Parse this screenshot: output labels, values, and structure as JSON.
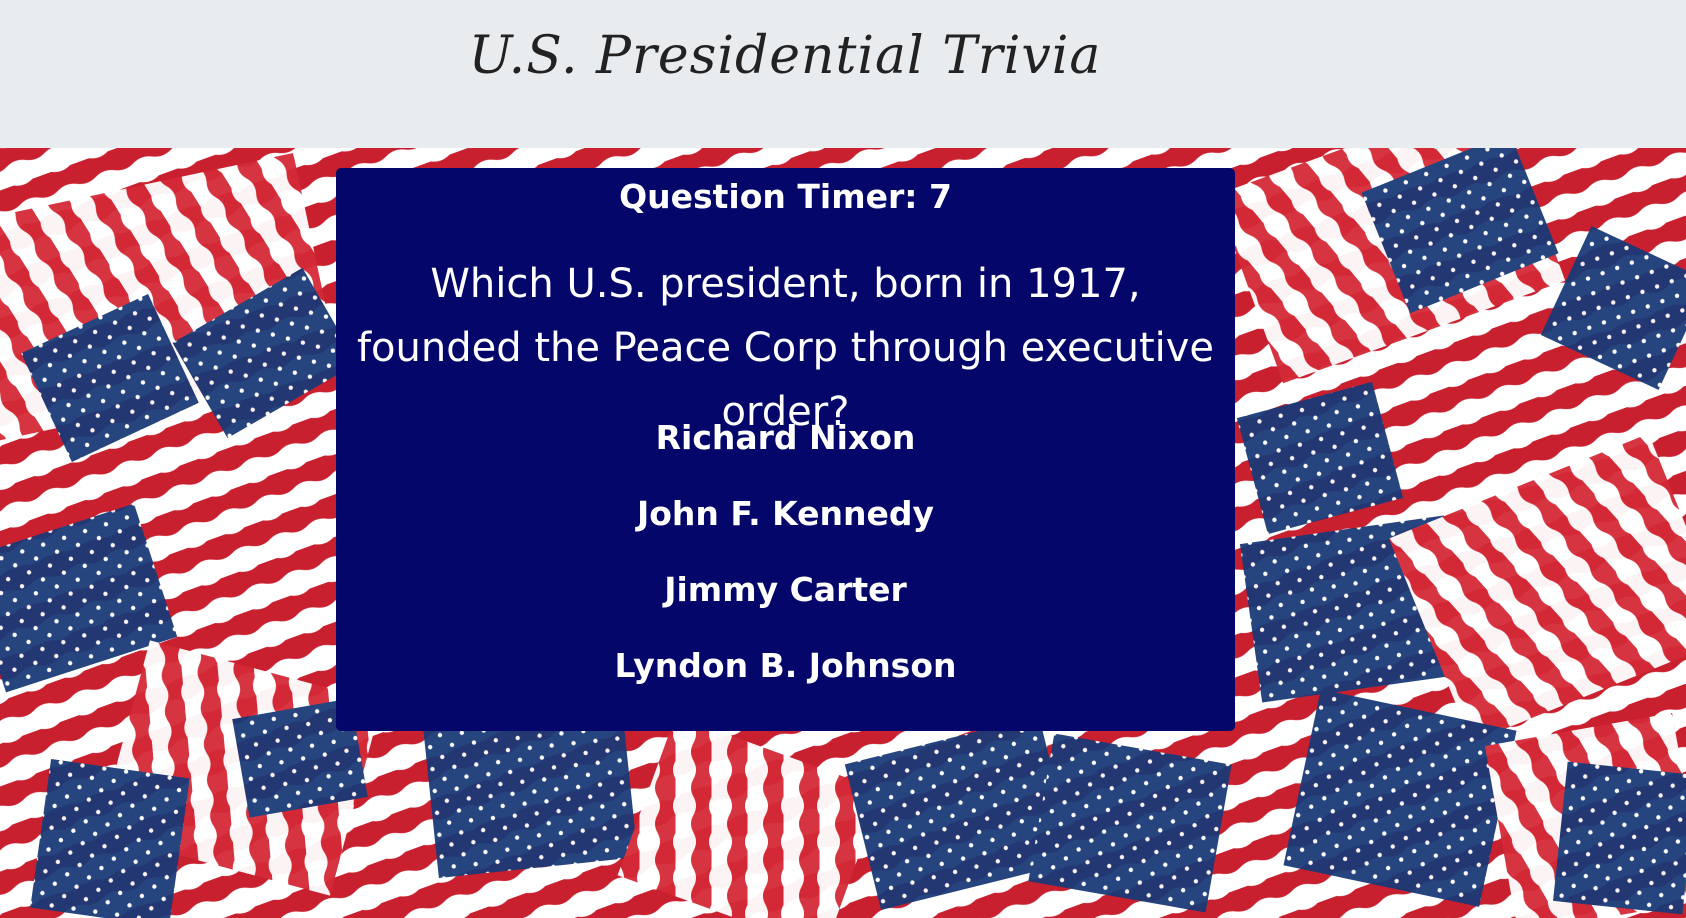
{
  "header": {
    "title": "U.S. Presidential Trivia"
  },
  "card": {
    "timer_label": "Question Timer:",
    "timer_value": "7",
    "question": "Which U.S. president, born in 1917, founded the Peace Corp through executive order?",
    "answers": [
      "Richard Nixon",
      "John F. Kennedy",
      "Jimmy Carter",
      "Lyndon B. Johnson"
    ]
  },
  "colors": {
    "header_bg": "#e9ecef",
    "card_bg": "#04066a",
    "flag_red": "#c8202f",
    "flag_blue": "#1b3a78",
    "flag_white": "#ffffff"
  },
  "background": {
    "icon": "american-flags-pattern"
  }
}
